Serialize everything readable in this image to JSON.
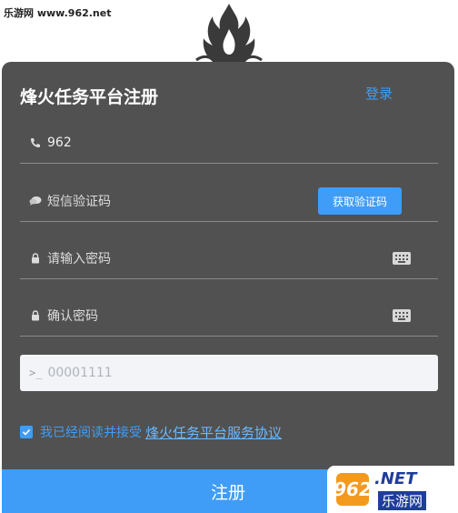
{
  "watermark": {
    "top_text": "乐游网 www.962.net",
    "bottom_num": "962",
    "bottom_net": ".NET",
    "bottom_cn": "乐游网"
  },
  "form": {
    "title": "烽火任务平台注册",
    "login_link": "登录",
    "phone_value": "962",
    "sms_placeholder": "短信验证码",
    "sms_button": "获取验证码",
    "password_placeholder": "请输入密码",
    "confirm_placeholder": "确认密码",
    "captcha_prompt": ">_",
    "captcha_value": "00001111",
    "agree_text": "我已经阅读并接受",
    "agree_link": "烽火任务平台服务协议",
    "agree_checked": true,
    "register_button": "注册"
  },
  "colors": {
    "card_bg": "#515151",
    "accent": "#3f9df7"
  },
  "icons": {
    "phone": "phone-icon",
    "sms": "chat-bubble-icon",
    "lock": "lock-icon",
    "keyboard": "keyboard-icon",
    "check": "check-icon",
    "logo": "flame-logo"
  }
}
